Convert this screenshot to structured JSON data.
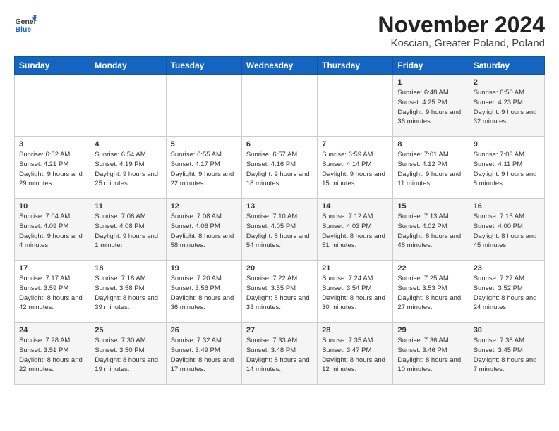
{
  "header": {
    "logo_general": "General",
    "logo_blue": "Blue",
    "title": "November 2024",
    "subtitle": "Koscian, Greater Poland, Poland"
  },
  "weekdays": [
    "Sunday",
    "Monday",
    "Tuesday",
    "Wednesday",
    "Thursday",
    "Friday",
    "Saturday"
  ],
  "weeks": [
    [
      {
        "day": "",
        "info": ""
      },
      {
        "day": "",
        "info": ""
      },
      {
        "day": "",
        "info": ""
      },
      {
        "day": "",
        "info": ""
      },
      {
        "day": "",
        "info": ""
      },
      {
        "day": "1",
        "info": "Sunrise: 6:48 AM\nSunset: 4:25 PM\nDaylight: 9 hours\nand 36 minutes."
      },
      {
        "day": "2",
        "info": "Sunrise: 6:50 AM\nSunset: 4:23 PM\nDaylight: 9 hours\nand 32 minutes."
      }
    ],
    [
      {
        "day": "3",
        "info": "Sunrise: 6:52 AM\nSunset: 4:21 PM\nDaylight: 9 hours\nand 29 minutes."
      },
      {
        "day": "4",
        "info": "Sunrise: 6:54 AM\nSunset: 4:19 PM\nDaylight: 9 hours\nand 25 minutes."
      },
      {
        "day": "5",
        "info": "Sunrise: 6:55 AM\nSunset: 4:17 PM\nDaylight: 9 hours\nand 22 minutes."
      },
      {
        "day": "6",
        "info": "Sunrise: 6:57 AM\nSunset: 4:16 PM\nDaylight: 9 hours\nand 18 minutes."
      },
      {
        "day": "7",
        "info": "Sunrise: 6:59 AM\nSunset: 4:14 PM\nDaylight: 9 hours\nand 15 minutes."
      },
      {
        "day": "8",
        "info": "Sunrise: 7:01 AM\nSunset: 4:12 PM\nDaylight: 9 hours\nand 11 minutes."
      },
      {
        "day": "9",
        "info": "Sunrise: 7:03 AM\nSunset: 4:11 PM\nDaylight: 9 hours\nand 8 minutes."
      }
    ],
    [
      {
        "day": "10",
        "info": "Sunrise: 7:04 AM\nSunset: 4:09 PM\nDaylight: 9 hours\nand 4 minutes."
      },
      {
        "day": "11",
        "info": "Sunrise: 7:06 AM\nSunset: 4:08 PM\nDaylight: 9 hours\nand 1 minute."
      },
      {
        "day": "12",
        "info": "Sunrise: 7:08 AM\nSunset: 4:06 PM\nDaylight: 8 hours\nand 58 minutes."
      },
      {
        "day": "13",
        "info": "Sunrise: 7:10 AM\nSunset: 4:05 PM\nDaylight: 8 hours\nand 54 minutes."
      },
      {
        "day": "14",
        "info": "Sunrise: 7:12 AM\nSunset: 4:03 PM\nDaylight: 8 hours\nand 51 minutes."
      },
      {
        "day": "15",
        "info": "Sunrise: 7:13 AM\nSunset: 4:02 PM\nDaylight: 8 hours\nand 48 minutes."
      },
      {
        "day": "16",
        "info": "Sunrise: 7:15 AM\nSunset: 4:00 PM\nDaylight: 8 hours\nand 45 minutes."
      }
    ],
    [
      {
        "day": "17",
        "info": "Sunrise: 7:17 AM\nSunset: 3:59 PM\nDaylight: 8 hours\nand 42 minutes."
      },
      {
        "day": "18",
        "info": "Sunrise: 7:18 AM\nSunset: 3:58 PM\nDaylight: 8 hours\nand 39 minutes."
      },
      {
        "day": "19",
        "info": "Sunrise: 7:20 AM\nSunset: 3:56 PM\nDaylight: 8 hours\nand 36 minutes."
      },
      {
        "day": "20",
        "info": "Sunrise: 7:22 AM\nSunset: 3:55 PM\nDaylight: 8 hours\nand 33 minutes."
      },
      {
        "day": "21",
        "info": "Sunrise: 7:24 AM\nSunset: 3:54 PM\nDaylight: 8 hours\nand 30 minutes."
      },
      {
        "day": "22",
        "info": "Sunrise: 7:25 AM\nSunset: 3:53 PM\nDaylight: 8 hours\nand 27 minutes."
      },
      {
        "day": "23",
        "info": "Sunrise: 7:27 AM\nSunset: 3:52 PM\nDaylight: 8 hours\nand 24 minutes."
      }
    ],
    [
      {
        "day": "24",
        "info": "Sunrise: 7:28 AM\nSunset: 3:51 PM\nDaylight: 8 hours\nand 22 minutes."
      },
      {
        "day": "25",
        "info": "Sunrise: 7:30 AM\nSunset: 3:50 PM\nDaylight: 8 hours\nand 19 minutes."
      },
      {
        "day": "26",
        "info": "Sunrise: 7:32 AM\nSunset: 3:49 PM\nDaylight: 8 hours\nand 17 minutes."
      },
      {
        "day": "27",
        "info": "Sunrise: 7:33 AM\nSunset: 3:48 PM\nDaylight: 8 hours\nand 14 minutes."
      },
      {
        "day": "28",
        "info": "Sunrise: 7:35 AM\nSunset: 3:47 PM\nDaylight: 8 hours\nand 12 minutes."
      },
      {
        "day": "29",
        "info": "Sunrise: 7:36 AM\nSunset: 3:46 PM\nDaylight: 8 hours\nand 10 minutes."
      },
      {
        "day": "30",
        "info": "Sunrise: 7:38 AM\nSunset: 3:45 PM\nDaylight: 8 hours\nand 7 minutes."
      }
    ]
  ]
}
